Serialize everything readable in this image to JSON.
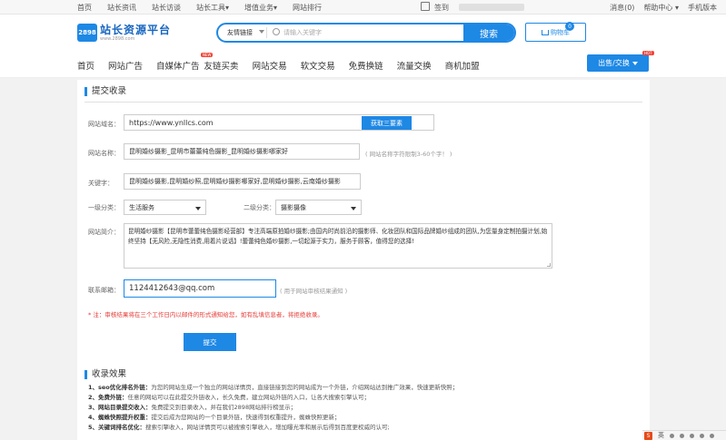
{
  "topbar": {
    "links": [
      "首页",
      "站长资讯",
      "站长访谈",
      "站长工具▾",
      "增值业务▾",
      "网站排行"
    ],
    "signin": "签到",
    "right": [
      "消息(0)",
      "帮助中心 ▾",
      "手机版本"
    ]
  },
  "header": {
    "logo_badge": "2898",
    "logo_title": "站长资源平台",
    "logo_url": "www.2898.com",
    "search_category": "友情链接",
    "search_placeholder": "请输入关键字",
    "search_button": "搜索",
    "cart_label": "购物车",
    "cart_count": "0"
  },
  "nav": {
    "items": [
      "首页",
      "网站广告",
      "自媒体广告",
      "友链买卖",
      "网站交易",
      "软文交易",
      "免费换链",
      "流量交换",
      "商机加盟"
    ],
    "new_badge": "NEW",
    "cta": "出售/交换",
    "hot_badge": "HOT"
  },
  "form": {
    "section_title": "提交收录",
    "url_label": "网站域名：",
    "url_value": "https://www.ynllcs.com",
    "tdk_button": "获取三要素",
    "name_label": "网站名称：",
    "name_value": "昆明婚纱摄影_昆明市蕾蕾纯色摄影_昆明婚纱摄影哪家好",
    "name_hint": "( 网站名称字符限制3-60个字！ )",
    "keywords_label": "关键字：",
    "keywords_value": "昆明婚纱摄影,昆明婚纱照,昆明婚纱摄影哪家好,昆明婚纱摄影,云南婚纱摄影",
    "cat1_label": "一级分类：",
    "cat1_value": "生活服务",
    "cat2_label": "二级分类：",
    "cat2_value": "摄影摄像",
    "intro_label": "网站简介：",
    "intro_value": "昆明婚纱摄影【昆明市蕾蕾纯色摄影经营部】专注高端原拍婚纱摄影;由国内时尚前沿的摄影师、化妆团队和国际品牌婚纱组成的团队,为您量身定制拍摄计划,始终坚持【无风险,无隐性消费,用着片说话】!蕾蕾纯色婚纱摄影,一切起源于实力，服务于顾客，值得您的选择!",
    "email_label": "联系邮箱：",
    "email_value": "1124412643@qq.com",
    "email_hint": "( 用于网站审核结果通知 )",
    "notice": "* 注：审核结果将在三个工作日内以邮件的形式通知给您，如有乱填信息者，将拒绝收录。",
    "submit": "提交"
  },
  "effects": {
    "section_title": "收录效果",
    "items": [
      {
        "title": "1、seo优化排名外链：",
        "text": "为您的网站生成一个独立的网站详情页，直接链接到您的网站成为一个外链，介绍网站达到推广效果，快速更新快照；"
      },
      {
        "title": "2、免费外链：",
        "text": "任意的网站可以在此提交外链收入，长久免费，建立网站外链的入口，让各大搜索引擎认可；"
      },
      {
        "title": "3、网站目录提交收入：",
        "text": "免费提交到目录收入，并在我们2898网站排行榜显示；"
      },
      {
        "title": "4、蜘蛛快照提升权重：",
        "text": "提交后成为您网站的一个目录外链，快速得到权重提升，蜘蛛快照更新；"
      },
      {
        "title": "5、关键词排名优化：",
        "text": "搜索引擎收入，网站详情页可以被搜索引擎收入，增加曝光率和展示后得到百度更权威的认可;"
      }
    ]
  },
  "tray": {
    "ime": "S",
    "lang": "英"
  }
}
